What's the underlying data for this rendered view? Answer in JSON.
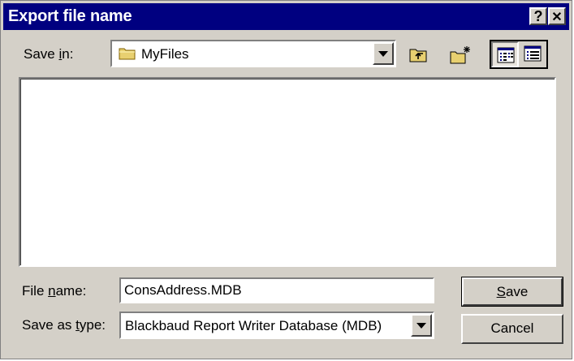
{
  "window": {
    "title": "Export file name",
    "help_glyph": "?",
    "close_glyph": "✕"
  },
  "save_in": {
    "label_pre": "Save ",
    "label_key": "i",
    "label_post": "n:",
    "value": "MyFiles",
    "icon": "folder-icon"
  },
  "toolbar": {
    "buttons": [
      {
        "name": "up-one-level",
        "icon": "up-folder-icon"
      },
      {
        "name": "create-new-folder",
        "icon": "new-folder-icon"
      },
      {
        "name": "list-view",
        "icon": "list-view-icon",
        "pressed": true
      },
      {
        "name": "details-view",
        "icon": "details-view-icon"
      }
    ]
  },
  "file_name": {
    "label_pre": "File ",
    "label_key": "n",
    "label_post": "ame:",
    "value": "ConsAddress.MDB"
  },
  "save_as_type": {
    "label_pre": "Save as ",
    "label_key": "t",
    "label_post": "ype:",
    "value": "Blackbaud Report Writer Database (MDB)"
  },
  "buttons": {
    "save_key": "S",
    "save_rest": "ave",
    "cancel": "Cancel"
  },
  "colors": {
    "titlebar": "#000080",
    "face": "#d4d0c8",
    "folder": "#e8d070"
  }
}
